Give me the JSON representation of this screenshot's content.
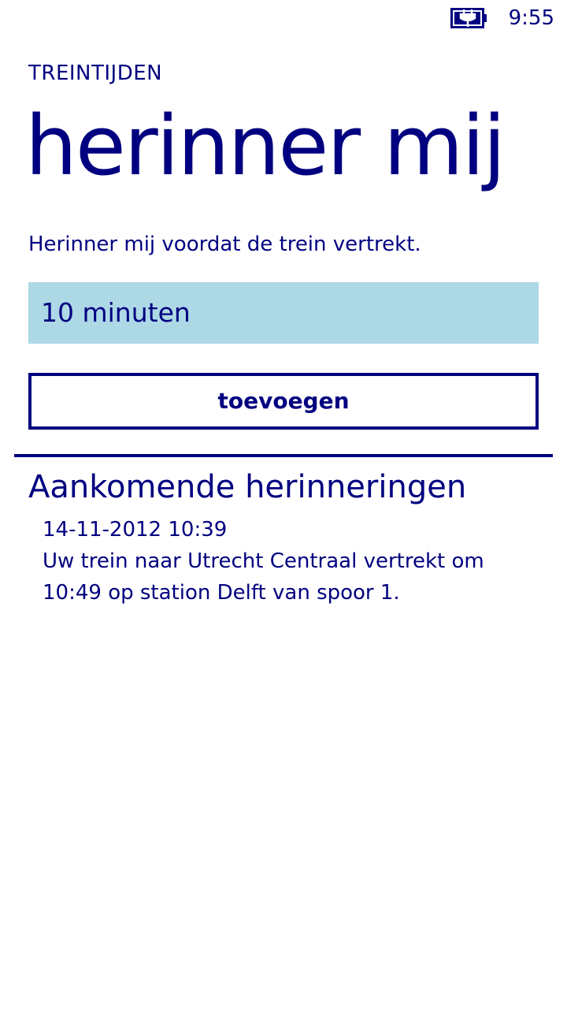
{
  "status_bar": {
    "battery_icon": "battery-charging-icon",
    "time": "9:55"
  },
  "header": {
    "app_title": "TREINTIJDEN",
    "page_title": "herinner mij"
  },
  "form": {
    "description": "Herinner mij voordat de trein vertrekt.",
    "picker_value": "10 minuten",
    "add_button_label": "toevoegen"
  },
  "reminders": {
    "heading": "Aankomende herinneringen",
    "items": [
      {
        "time": "14-11-2012 10:39",
        "message": "Uw trein naar Utrecht Centraal vertrekt om 10:49 op station Delft van spoor 1."
      }
    ]
  },
  "colors": {
    "accent": "#000080",
    "picker_background": "#add8e6",
    "background": "#ffffff"
  }
}
